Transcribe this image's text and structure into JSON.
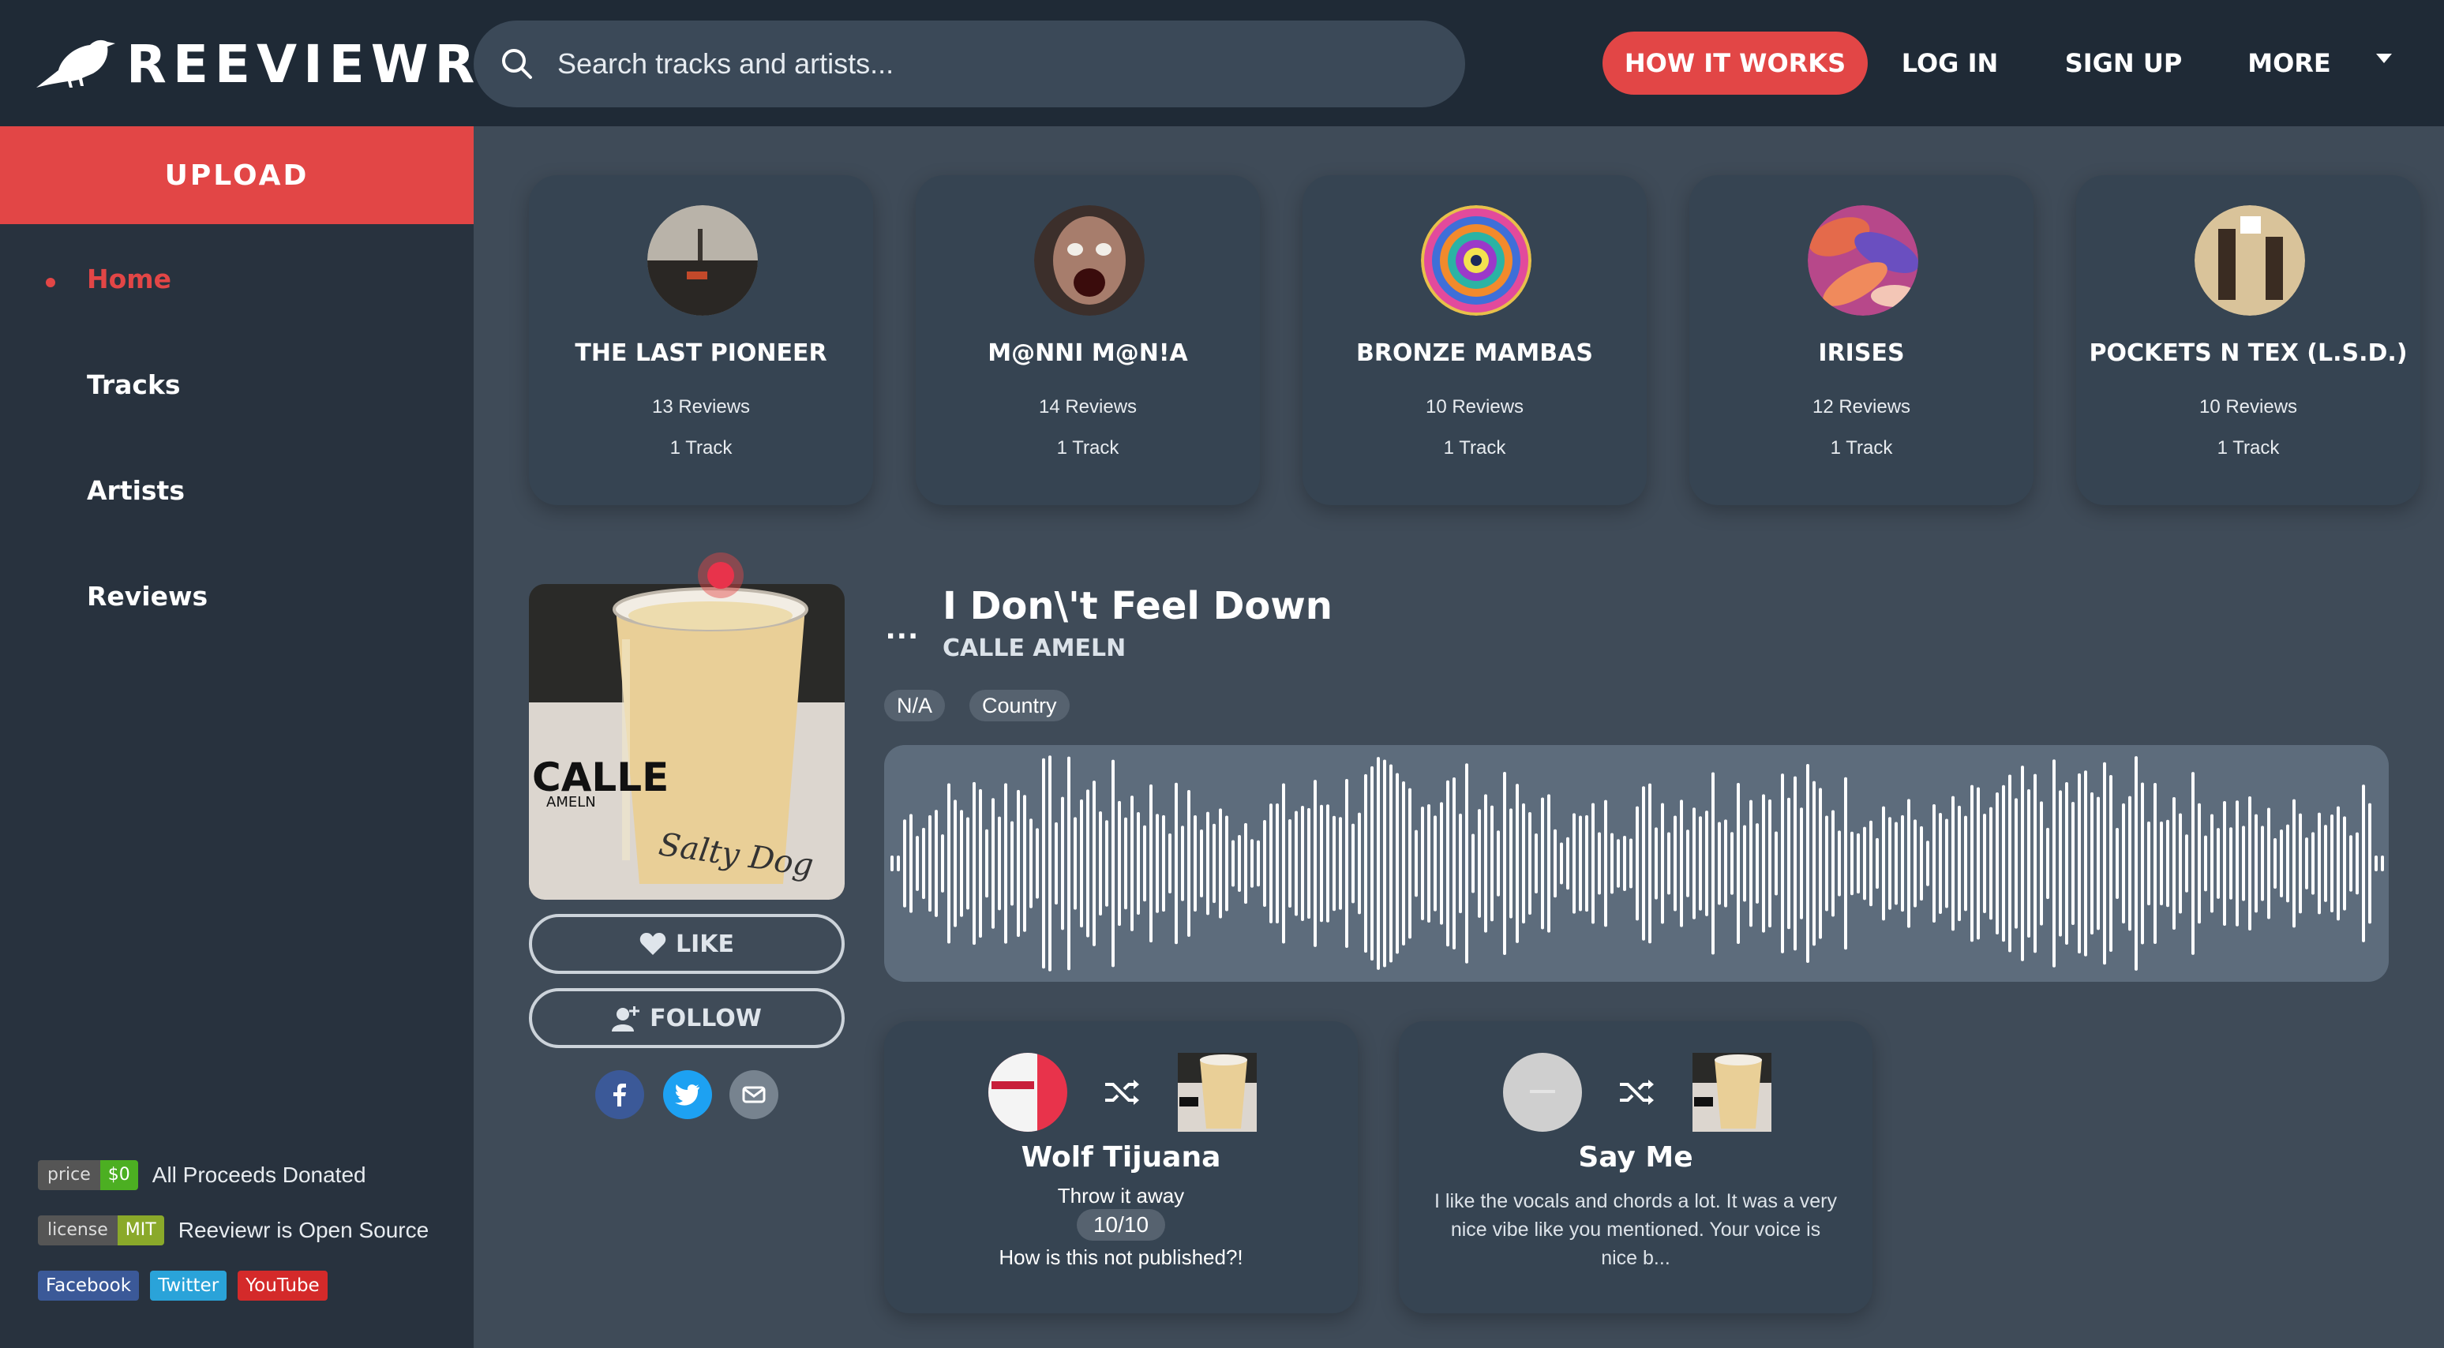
{
  "app": {
    "name": "REEVIEWR"
  },
  "search": {
    "placeholder": "Search tracks and artists..."
  },
  "nav": {
    "how": "HOW IT WORKS",
    "login": "LOG IN",
    "signup": "SIGN UP",
    "more": "MORE"
  },
  "sidebar": {
    "upload": "UPLOAD",
    "items": [
      {
        "label": "Home",
        "active": true
      },
      {
        "label": "Tracks"
      },
      {
        "label": "Artists"
      },
      {
        "label": "Reviews"
      }
    ],
    "badges": [
      {
        "left": "price",
        "right": "$0",
        "color": "#4caf22",
        "text": "All Proceeds Donated"
      },
      {
        "left": "license",
        "right": "MIT",
        "color": "#8aa92a",
        "text": "Reeviewr is Open Source"
      }
    ],
    "social": [
      {
        "label": "Facebook",
        "color": "#3b5998"
      },
      {
        "label": "Twitter",
        "color": "#2aa3d9"
      },
      {
        "label": "YouTube",
        "color": "#d42a2a"
      }
    ]
  },
  "artists": [
    {
      "name": "THE LAST PIONEER",
      "reviews": "13 Reviews",
      "tracks": "1 Track"
    },
    {
      "name": "M@NNI M@N!A",
      "reviews": "14 Reviews",
      "tracks": "1 Track"
    },
    {
      "name": "BRONZE MAMBAS",
      "reviews": "10 Reviews",
      "tracks": "1 Track"
    },
    {
      "name": "IRISES",
      "reviews": "12 Reviews",
      "tracks": "1 Track"
    },
    {
      "name": "POCKETS N TEX (L.S.D.)",
      "reviews": "10 Reviews",
      "tracks": "1 Track"
    }
  ],
  "track": {
    "title": "I Don\\'t Feel Down",
    "artist": "CALLE AMELN",
    "tags": [
      "N/A",
      "Country"
    ],
    "like": "LIKE",
    "follow": "FOLLOW",
    "cover_text": {
      "brand": "CALLE",
      "sub": "AMELN",
      "script": "Salty Dog"
    }
  },
  "reviews": [
    {
      "title": "Wolf Tijuana",
      "line": "Throw it away",
      "score": "10/10",
      "comment": "How is this not published?!"
    },
    {
      "title": "Say Me",
      "text": "I like the vocals and chords a lot. It was a very nice vibe like you mentioned. Your voice is nice b..."
    }
  ],
  "colors": {
    "accent": "#e24646",
    "bg": "#3f4b58",
    "sidebar": "#28323e",
    "header": "#1f2a36",
    "card": "#364452"
  }
}
